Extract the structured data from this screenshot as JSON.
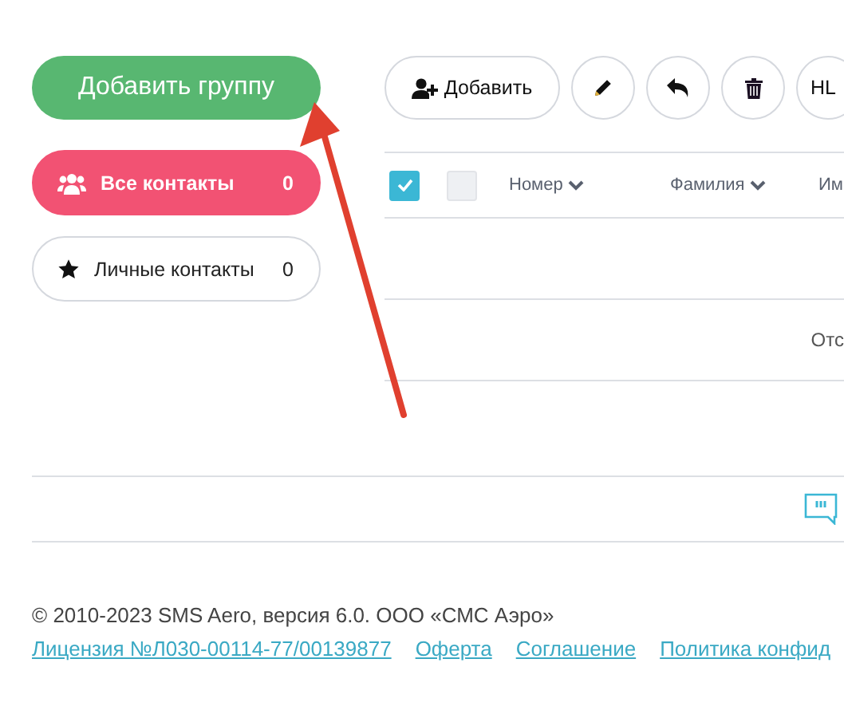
{
  "sidebar": {
    "add_group_button": "Добавить группу",
    "groups": [
      {
        "kind": "users",
        "label": "Все контакты",
        "count": "0",
        "selected": true
      },
      {
        "kind": "star",
        "label": "Личные контакты",
        "count": "0",
        "selected": false
      }
    ]
  },
  "toolbar": [
    {
      "kind": "add",
      "label": "Добавить"
    },
    {
      "kind": "edit"
    },
    {
      "kind": "undo"
    },
    {
      "kind": "delete"
    },
    {
      "kind": "text",
      "label": "HL"
    }
  ],
  "table": {
    "select_all": {
      "checked": true
    },
    "select_other": {
      "checked": false
    },
    "columns": [
      {
        "label": "Номер",
        "sortable": true
      },
      {
        "label": "Фамилия",
        "sortable": true
      },
      {
        "label": "Им"
      }
    ],
    "empty_message": "Отс"
  },
  "footer": {
    "copyright": "© 2010-2023 SMS Aero, версия 6.0. ООО «СМС Аэро»",
    "links": [
      "Лицензия №Л030-00114-77/00139877",
      "Оферта",
      "Соглашение",
      "Политика конфид"
    ]
  }
}
